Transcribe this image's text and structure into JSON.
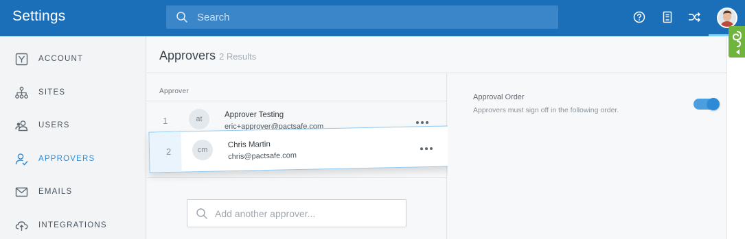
{
  "app": {
    "title": "Settings"
  },
  "search": {
    "placeholder": "Search"
  },
  "toolbar": {
    "icons": [
      "help-circle-icon",
      "document-icon",
      "shuffle-icon"
    ],
    "avatar": "user-avatar"
  },
  "sidebar": {
    "items": [
      {
        "label": "ACCOUNT",
        "icon": "account-icon",
        "active": false
      },
      {
        "label": "SITES",
        "icon": "sitemap-icon",
        "active": false
      },
      {
        "label": "USERS",
        "icon": "users-icon",
        "active": false
      },
      {
        "label": "APPROVERS",
        "icon": "approver-check-icon",
        "active": true
      },
      {
        "label": "EMAILS",
        "icon": "envelope-icon",
        "active": false
      },
      {
        "label": "INTEGRATIONS",
        "icon": "cloud-icon",
        "active": false
      }
    ]
  },
  "main": {
    "title": "Approvers",
    "result_count": "2 Results",
    "column_header": "Approver",
    "approvers": [
      {
        "order": "1",
        "initials": "at",
        "name": "Approver Testing",
        "email": "eric+approver@pactsafe.com"
      },
      {
        "order": "2",
        "initials": "cm",
        "name": "Chris Martin",
        "email": "chris@pactsafe.com"
      }
    ],
    "add_placeholder": "Add another approver..."
  },
  "settings": {
    "approval_order_label": "Approval Order",
    "approval_order_desc": "Approvers must sign off in the following order.",
    "approval_order_enabled": true
  },
  "colors": {
    "brand": "#1b6fb9",
    "accent": "#2d8ad6",
    "help_tab": "#6fb53d"
  }
}
